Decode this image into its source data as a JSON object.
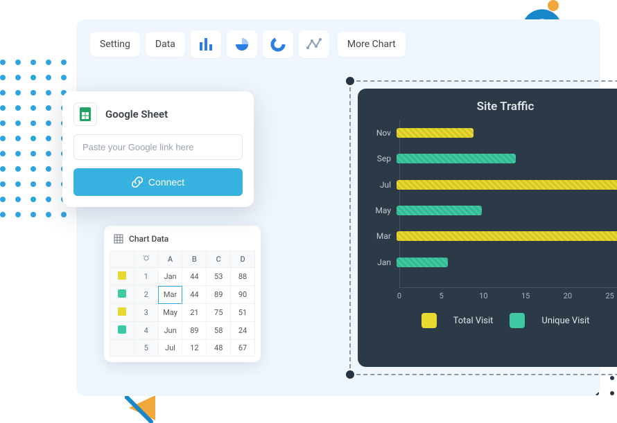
{
  "toolbar": {
    "setting": "Setting",
    "data": "Data",
    "more": "More Chart"
  },
  "sheet": {
    "title": "Google Sheet",
    "placeholder": "Paste your Google link here",
    "connect": "Connect"
  },
  "datacard": {
    "title": "Chart Data",
    "headers": [
      "",
      "",
      "A",
      "B",
      "C",
      "D"
    ],
    "rows": [
      {
        "swatch": "y",
        "idx": "1",
        "cells": [
          "Jan",
          "44",
          "53",
          "88"
        ]
      },
      {
        "swatch": "g",
        "idx": "2",
        "cells": [
          "Mar",
          "44",
          "89",
          "90"
        ],
        "selectedCol": 0
      },
      {
        "swatch": "y",
        "idx": "3",
        "cells": [
          "May",
          "21",
          "75",
          "51"
        ]
      },
      {
        "swatch": "g",
        "idx": "4",
        "cells": [
          "Jun",
          "89",
          "58",
          "24"
        ]
      },
      {
        "swatch": "",
        "idx": "5",
        "cells": [
          "Jul",
          "12",
          "48",
          "67"
        ]
      }
    ]
  },
  "chart_data": {
    "type": "bar",
    "orientation": "horizontal",
    "title": "Site Traffic",
    "xlabel": "",
    "ylabel": "",
    "xlim": [
      0,
      28
    ],
    "ticks": [
      0,
      5,
      10,
      15,
      20,
      25
    ],
    "categories": [
      "Nov",
      "Sep",
      "Jul",
      "May",
      "Mar",
      "Jan"
    ],
    "series": [
      {
        "name": "Total Visit",
        "color": "#e7d92f",
        "values": {
          "Nov": 9,
          "Jul": 28,
          "Mar": 27
        }
      },
      {
        "name": "Unique Visit",
        "color": "#3fc9a3",
        "values": {
          "Sep": 14,
          "May": 10,
          "Jan": 6
        }
      }
    ],
    "legend": [
      "Total Visit",
      "Unique Visit"
    ]
  }
}
